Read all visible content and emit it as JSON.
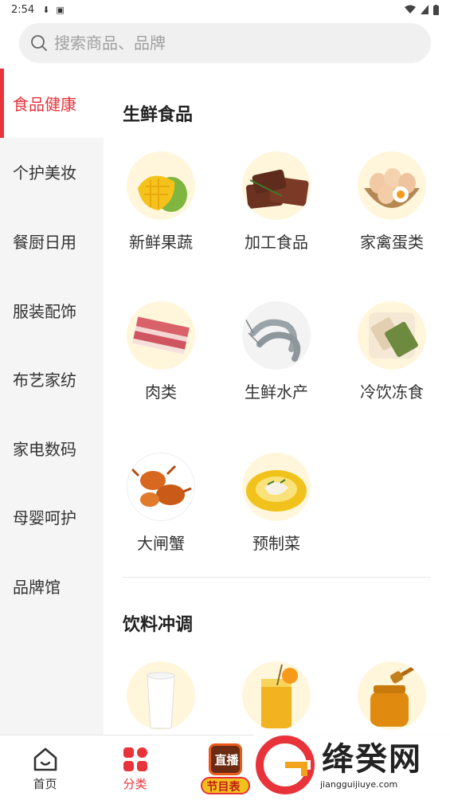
{
  "status_bar": {
    "time": "2:54"
  },
  "search": {
    "placeholder": "搜索商品、品牌"
  },
  "sidebar": {
    "items": [
      {
        "label": "食品健康",
        "active": true
      },
      {
        "label": "个护美妆"
      },
      {
        "label": "餐厨日用"
      },
      {
        "label": "服装配饰"
      },
      {
        "label": "布艺家纺"
      },
      {
        "label": "家电数码"
      },
      {
        "label": "母婴呵护"
      },
      {
        "label": "品牌馆"
      }
    ]
  },
  "sections": [
    {
      "title": "生鲜食品",
      "items": [
        {
          "label": "新鲜果蔬",
          "icon": "mango-icon"
        },
        {
          "label": "加工食品",
          "icon": "beef-jerky-icon"
        },
        {
          "label": "家禽蛋类",
          "icon": "eggs-icon"
        },
        {
          "label": "肉类",
          "icon": "pork-belly-icon"
        },
        {
          "label": "生鲜水产",
          "icon": "shrimp-icon"
        },
        {
          "label": "冷饮冻食",
          "icon": "popsicle-icon"
        },
        {
          "label": "大闸蟹",
          "icon": "crab-icon"
        },
        {
          "label": "预制菜",
          "icon": "prepared-dish-icon"
        }
      ]
    },
    {
      "title": "饮料冲调",
      "items": [
        {
          "label": "",
          "icon": "milk-icon"
        },
        {
          "label": "",
          "icon": "juice-icon"
        },
        {
          "label": "",
          "icon": "honey-icon"
        }
      ]
    }
  ],
  "bottom_nav": {
    "items": [
      {
        "label": "首页",
        "icon": "home-icon"
      },
      {
        "label": "分类",
        "icon": "category-icon",
        "active": true
      },
      {
        "label": "直播",
        "sub": "节目表",
        "icon": "live-tv-icon"
      }
    ]
  },
  "watermark": {
    "text": "绛癸网",
    "url": "jiangguijiuye.com"
  },
  "colors": {
    "accent": "#e8333a",
    "sidebar_bg": "#f5f5f5",
    "thumb_bg": "#fff6dc"
  }
}
